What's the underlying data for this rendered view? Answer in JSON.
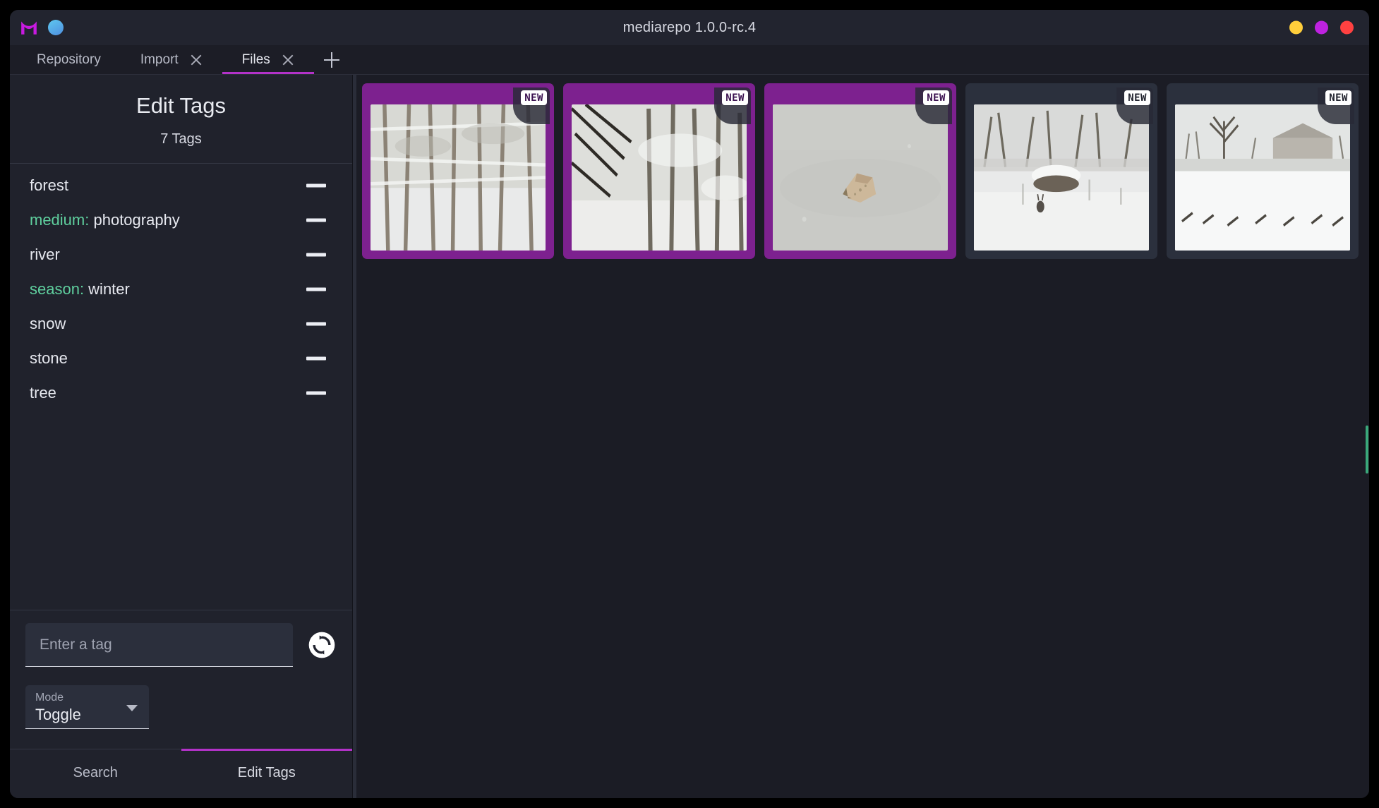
{
  "window": {
    "title": "mediarepo 1.0.0-rc.4",
    "logo_icon": "mediarepo-logo-icon",
    "status_dot_icon": "connection-dot-icon",
    "controls": [
      {
        "name": "minimize-button",
        "color": "#FFCE3B"
      },
      {
        "name": "maximize-button",
        "color": "#BE22E0"
      },
      {
        "name": "close-button",
        "color": "#FF4141"
      }
    ]
  },
  "tabs": {
    "items": [
      {
        "label": "Repository",
        "closable": false,
        "active": false
      },
      {
        "label": "Import",
        "closable": true,
        "active": false
      },
      {
        "label": "Files",
        "closable": true,
        "active": true
      }
    ],
    "add_icon": "plus-icon",
    "close_icon": "close-icon",
    "active_indicator_color": "#b332c9"
  },
  "sidebar": {
    "title": "Edit Tags",
    "tag_count_label": "7 Tags",
    "tags": [
      {
        "namespace": "",
        "value": "forest",
        "remove_icon": "minus-icon"
      },
      {
        "namespace": "medium: ",
        "value": "photography",
        "remove_icon": "minus-icon"
      },
      {
        "namespace": "",
        "value": "river",
        "remove_icon": "minus-icon"
      },
      {
        "namespace": "season: ",
        "value": "winter",
        "remove_icon": "minus-icon"
      },
      {
        "namespace": "",
        "value": "snow",
        "remove_icon": "minus-icon"
      },
      {
        "namespace": "",
        "value": "stone",
        "remove_icon": "minus-icon"
      },
      {
        "namespace": "",
        "value": "tree",
        "remove_icon": "minus-icon"
      }
    ],
    "namespace_color": "#5fcf9e",
    "tag_input": {
      "placeholder": "Enter a tag",
      "value": ""
    },
    "sync_button": {
      "icon": "sync-refresh-icon"
    },
    "mode_select": {
      "label": "Mode",
      "value": "Toggle",
      "caret_icon": "chevron-down-icon"
    },
    "bottom_tabs": [
      {
        "label": "Search",
        "active": false
      },
      {
        "label": "Edit Tags",
        "active": true
      }
    ]
  },
  "content": {
    "badge_label": "NEW",
    "selected_color": "#7d218f",
    "scrollbar_color": "#3aa87a",
    "files": [
      {
        "name": "file-thumbnail-1",
        "selected": true,
        "badge": "NEW",
        "alt": "snowy-forest-tall-trees"
      },
      {
        "name": "file-thumbnail-2",
        "selected": true,
        "badge": "NEW",
        "alt": "snowy-forest-dark-branches"
      },
      {
        "name": "file-thumbnail-3",
        "selected": true,
        "badge": "NEW",
        "alt": "stone-on-ice-grey"
      },
      {
        "name": "file-thumbnail-4",
        "selected": false,
        "badge": "NEW",
        "alt": "snowy-field-boulder-deer"
      },
      {
        "name": "file-thumbnail-5",
        "selected": false,
        "badge": "NEW",
        "alt": "snowy-field-lone-tree"
      }
    ]
  }
}
